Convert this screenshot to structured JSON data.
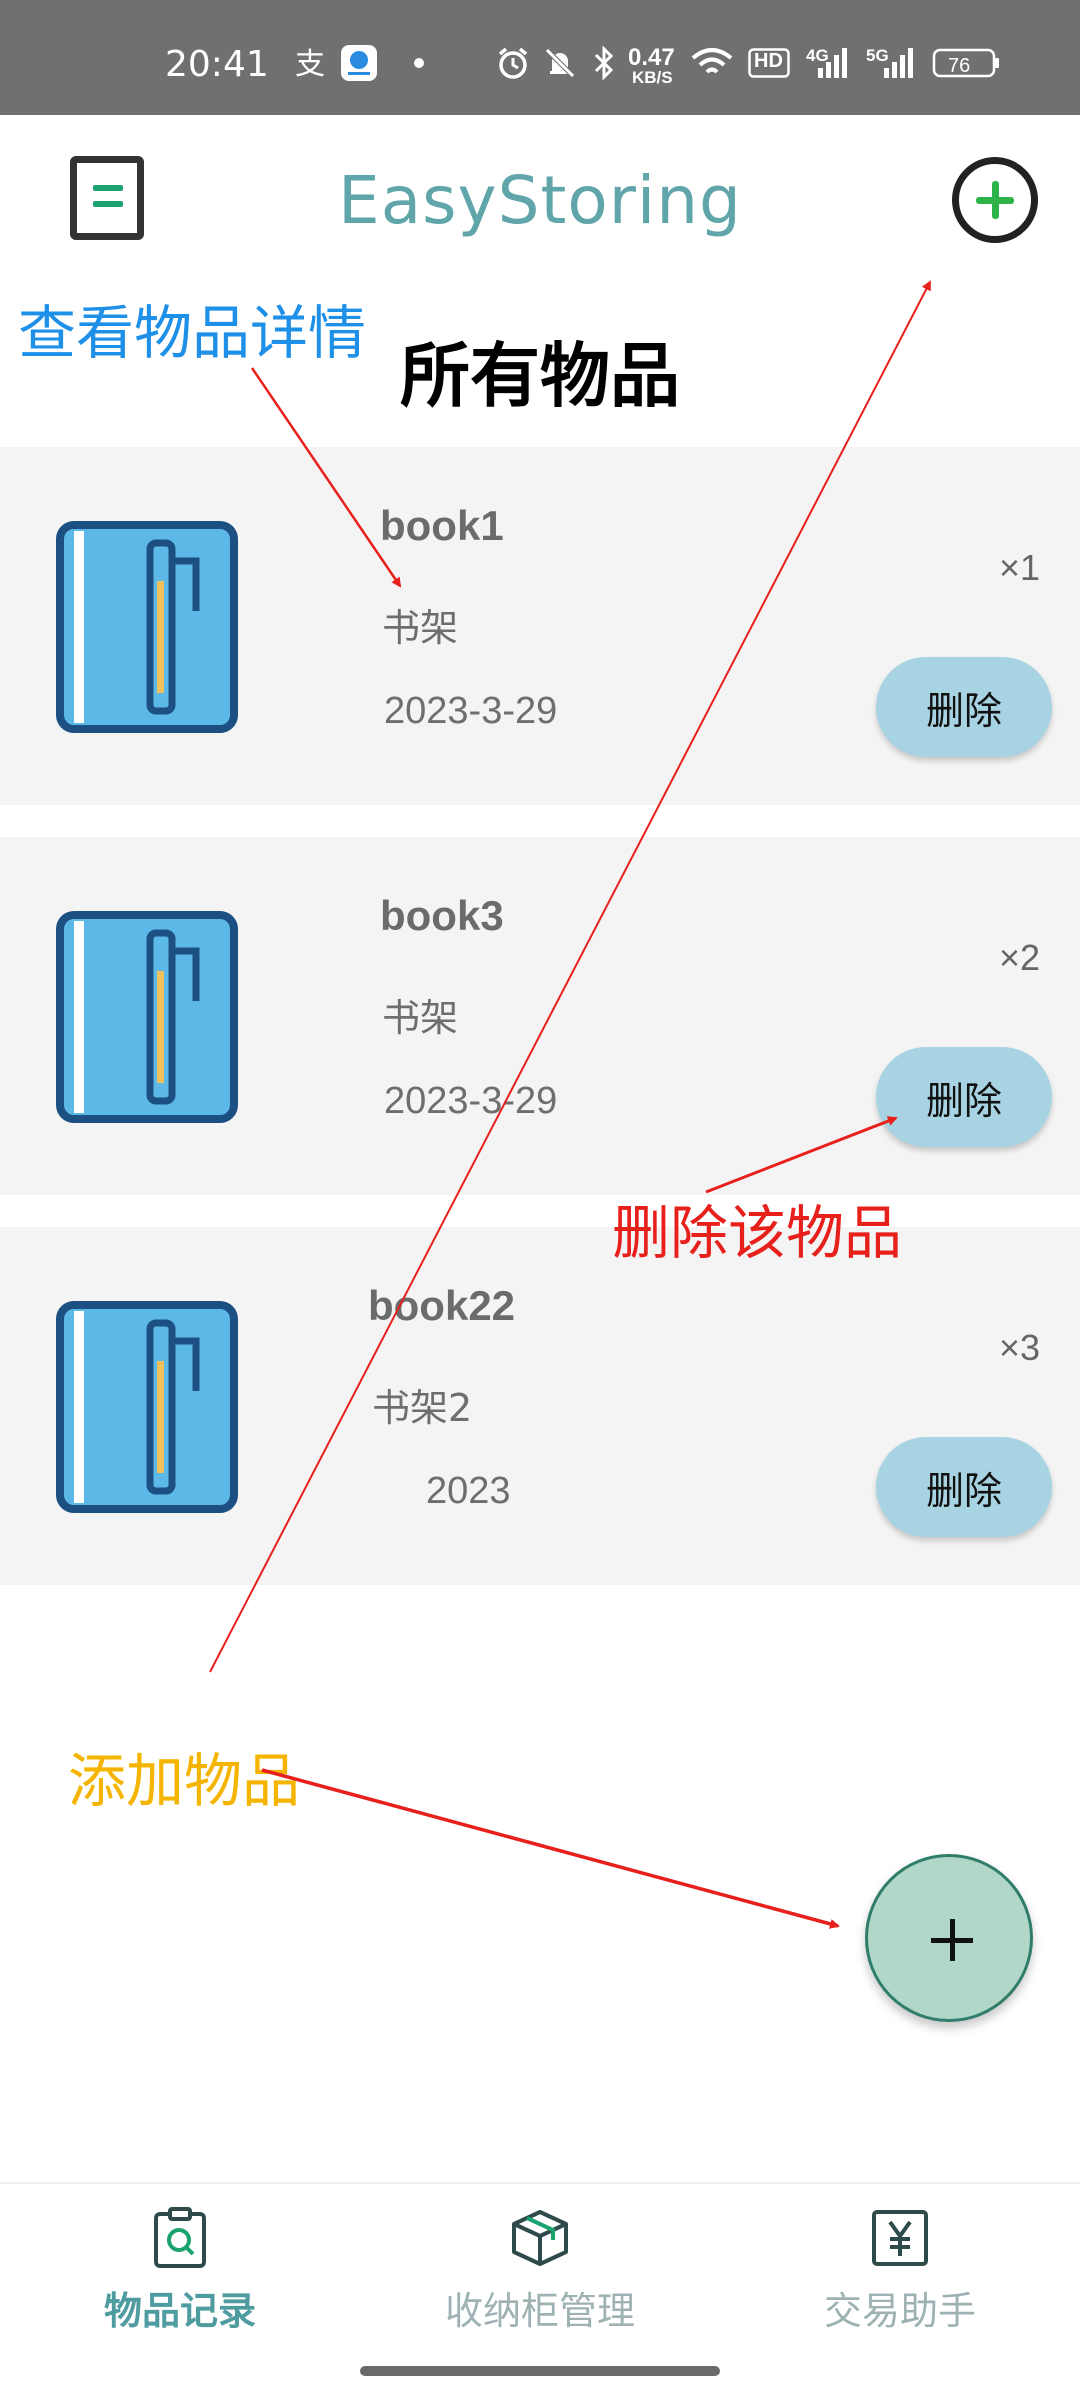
{
  "status_bar": {
    "time": "20:41",
    "net_speed_value": "0.47",
    "net_speed_unit": "KB/S",
    "hd_label": "HD",
    "lte_label": "4G",
    "fiveg_label": "5G",
    "battery": "76",
    "icons": [
      "alipay-icon",
      "app-notification-icon",
      "dot-icon",
      "alarm-icon",
      "mute-icon",
      "bluetooth-icon",
      "wifi-icon",
      "signal-icon",
      "battery-icon"
    ]
  },
  "header": {
    "title": "EasyStoring",
    "menu_icon": "document-menu-icon",
    "add_icon": "add-circle-icon",
    "accent_color": "#2db34a"
  },
  "section": {
    "title": "所有物品"
  },
  "items": [
    {
      "name": "book1",
      "location": "书架",
      "date": "2023-3-29",
      "quantity": "×1",
      "delete_label": "删除"
    },
    {
      "name": "book3",
      "location": "书架",
      "date": "2023-3-29",
      "quantity": "×2",
      "delete_label": "删除"
    },
    {
      "name": "book22",
      "location": "书架2",
      "date": "2023",
      "quantity": "×3",
      "delete_label": "删除"
    }
  ],
  "annotations": {
    "view_details": "查看物品详情",
    "delete_item": "删除该物品",
    "add_item": "添加物品",
    "colors": {
      "view_details": "#1e90e8",
      "delete_item": "#e8201c",
      "add_item": "#f5b400",
      "arrow": "#e8201c"
    }
  },
  "fab": {
    "icon": "plus-icon"
  },
  "bottom_nav": {
    "items": [
      {
        "label": "物品记录",
        "icon": "record-clipboard-icon",
        "active": true
      },
      {
        "label": "收纳柜管理",
        "icon": "box-icon",
        "active": false
      },
      {
        "label": "交易助手",
        "icon": "yen-doc-icon",
        "active": false
      }
    ],
    "active_color": "#4e9ba0"
  }
}
